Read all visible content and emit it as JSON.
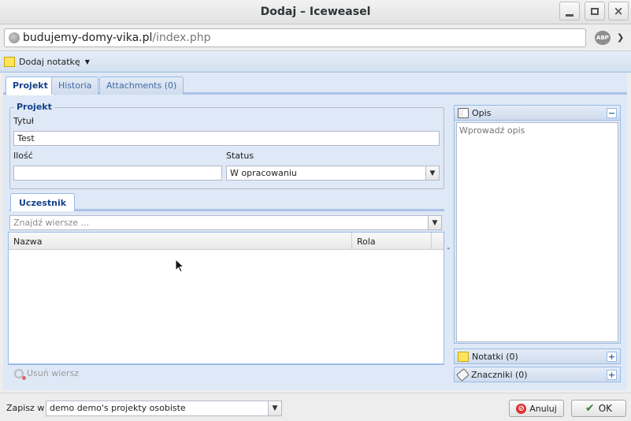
{
  "window": {
    "title": "Dodaj – Iceweasel",
    "buttons": {
      "minimize": "minimize",
      "maximize": "maximize",
      "close": "×"
    }
  },
  "address": {
    "domain": "budujemy-domy-vika.pl",
    "path": "/index.php",
    "abp_label": "ABP"
  },
  "toolbar": {
    "add_note_label": "Dodaj notatkę"
  },
  "tabs": [
    {
      "label": "Projekt",
      "active": true
    },
    {
      "label": "Historia",
      "active": false
    },
    {
      "label": "Attachments (0)",
      "active": false
    }
  ],
  "form": {
    "legend": "Projekt",
    "title_label": "Tytuł",
    "title_value": "Test",
    "quantity_label": "Ilość",
    "quantity_value": "",
    "status_label": "Status",
    "status_value": "W opracowaniu"
  },
  "participants": {
    "tab_label": "Uczestnik",
    "search_placeholder": "Znajdź wiersze ...",
    "columns": [
      "Nazwa",
      "Rola"
    ],
    "rows": [],
    "remove_row_label": "Usuń wiersz"
  },
  "right_panel": {
    "description_title": "Opis",
    "description_placeholder": "Wprowadź opis",
    "notes_title": "Notatki (0)",
    "tags_title": "Znaczniki (0)",
    "collapse_symbol": "−",
    "expand_symbol": "+"
  },
  "footer": {
    "save_in_label": "Zapisz w",
    "save_in_value": "demo demo's projekty osobiste",
    "cancel_label": "Anuluj",
    "ok_label": "OK"
  },
  "colors": {
    "panel_bg": "#dfe8f6",
    "border_blue": "#99bbe8",
    "header_blue": "#15428b"
  }
}
